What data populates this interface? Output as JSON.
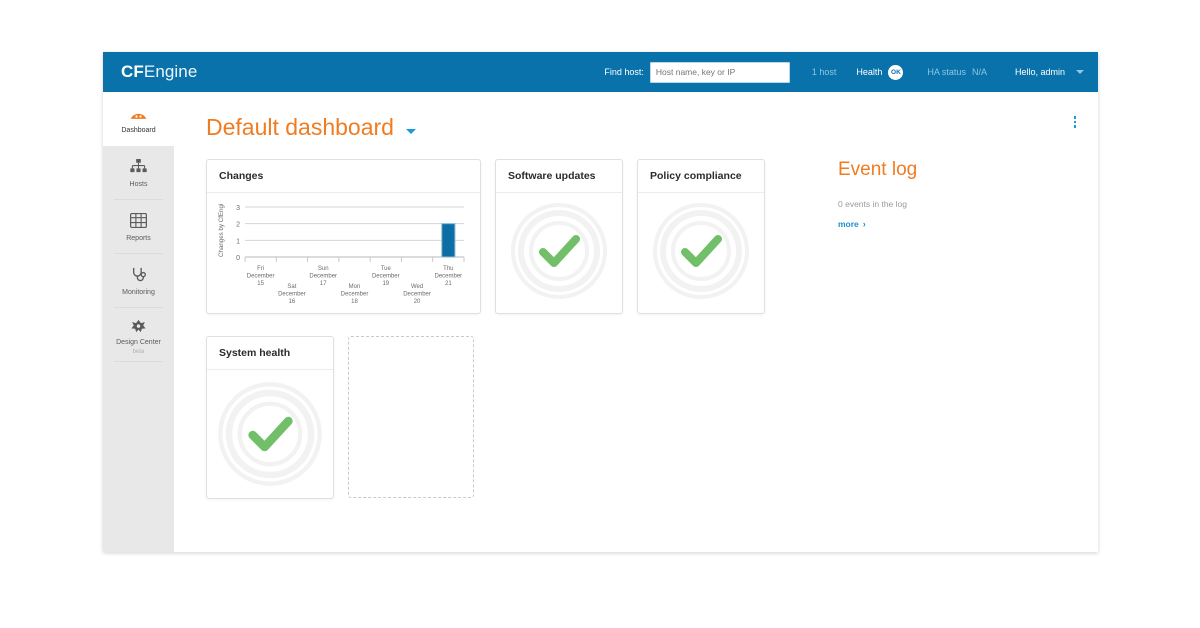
{
  "topbar": {
    "logo_bold": "CF",
    "logo_light": "Engine",
    "find_host_label": "Find host:",
    "find_host_placeholder": "Host name, key or IP",
    "find_host_value": "",
    "host_count": "1 host",
    "health_label": "Health",
    "health_status": "OK",
    "ha_label": "HA status",
    "ha_value": "N/A",
    "user_greeting": "Hello, admin",
    "accent_blue": "#0a72ab"
  },
  "sidebar": {
    "items": [
      {
        "label": "Dashboard",
        "icon": "gauge-icon",
        "sub": "",
        "active": true
      },
      {
        "label": "Hosts",
        "icon": "hosts-tree-icon",
        "sub": "",
        "active": false
      },
      {
        "label": "Reports",
        "icon": "grid-table-icon",
        "sub": "",
        "active": false
      },
      {
        "label": "Monitoring",
        "icon": "stethoscope-icon",
        "sub": "",
        "active": false
      },
      {
        "label": "Design Center",
        "icon": "sprocket-icon",
        "sub": "beta",
        "active": false
      }
    ]
  },
  "page": {
    "title": "Default dashboard",
    "menu_icon": "kebab-menu-icon",
    "accent_orange": "#f07c22"
  },
  "widgets": {
    "changes": {
      "title": "Changes"
    },
    "software_updates": {
      "title": "Software updates",
      "status": "ok"
    },
    "policy_compliance": {
      "title": "Policy compliance",
      "status": "ok"
    },
    "system_health": {
      "title": "System health",
      "status": "ok"
    },
    "empty_slot": {
      "title": ""
    }
  },
  "event_log": {
    "title": "Event log",
    "count_text": "0 events in the log",
    "more_label": "more",
    "more_chevron": "›"
  },
  "chart_data": {
    "type": "bar",
    "title": "Changes",
    "xlabel": "",
    "ylabel": "Changes by CfEngi",
    "categories": [
      "Fri December 15",
      "Sat December 16",
      "Sun December 17",
      "Mon December 18",
      "Tue December 19",
      "Wed December 20",
      "Thu December 21"
    ],
    "tick_labels": [
      {
        "day": "Fri",
        "month": "December",
        "date": "15",
        "row": 0
      },
      {
        "day": "Sat",
        "month": "December",
        "date": "16",
        "row": 1
      },
      {
        "day": "Sun",
        "month": "December",
        "date": "17",
        "row": 0
      },
      {
        "day": "Mon",
        "month": "December",
        "date": "18",
        "row": 1
      },
      {
        "day": "Tue",
        "month": "December",
        "date": "19",
        "row": 0
      },
      {
        "day": "Wed",
        "month": "December",
        "date": "20",
        "row": 1
      },
      {
        "day": "Thu",
        "month": "December",
        "date": "21",
        "row": 0
      }
    ],
    "values": [
      0,
      0,
      0,
      0,
      0,
      0,
      2
    ],
    "ytick_labels": [
      "0",
      "1",
      "2",
      "3"
    ],
    "ylim": [
      0,
      3
    ],
    "grid": true,
    "bar_color": "#0c6ea5",
    "bar_border": "#8cb8d4",
    "legend": "none"
  },
  "colors": {
    "check_green": "#72bf6a",
    "ring_gray": "#f1f1f1",
    "page_bg": "#e8e8e8"
  }
}
